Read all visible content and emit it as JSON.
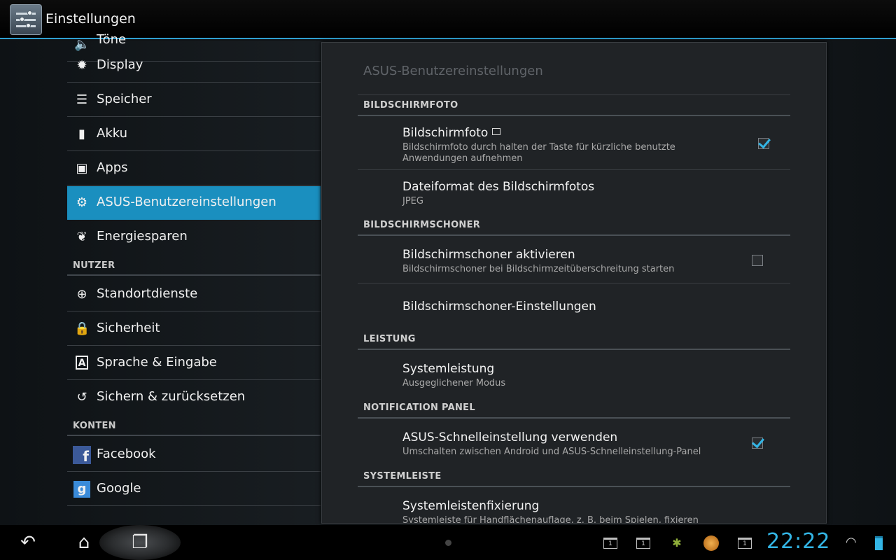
{
  "actionbar": {
    "title": "Einstellungen"
  },
  "sidebar": {
    "items": [
      {
        "label": "Töne"
      },
      {
        "label": "Display"
      },
      {
        "label": "Speicher"
      },
      {
        "label": "Akku"
      },
      {
        "label": "Apps"
      },
      {
        "label": "ASUS-Benutzereinstellungen"
      },
      {
        "label": "Energiesparen"
      },
      {
        "label": "Standortdienste"
      },
      {
        "label": "Sicherheit"
      },
      {
        "label": "Sprache & Eingabe"
      },
      {
        "label": "Sichern & zurücksetzen"
      },
      {
        "label": "Facebook"
      },
      {
        "label": "Google"
      }
    ],
    "sections": [
      "NUTZER",
      "KONTEN"
    ]
  },
  "panel": {
    "title": "ASUS-Benutzereinstellungen",
    "headers": [
      "BILDSCHIRMFOTO",
      "BILDSCHIRMSCHONER",
      "LEISTUNG",
      "NOTIFICATION PANEL",
      "SYSTEMLEISTE"
    ],
    "prefs": [
      {
        "title": "Bildschirmfoto",
        "summary": "Bildschirmfoto durch halten der Taste für kürzliche benutzte Anwendungen aufnehmen",
        "checked": true
      },
      {
        "title": "Dateiformat des Bildschirmfotos",
        "summary": "JPEG"
      },
      {
        "title": "Bildschirmschoner aktivieren",
        "summary": "Bildschirmschoner bei Bildschirmzeitüberschreitung starten",
        "checked": false
      },
      {
        "title": "Bildschirmschoner-Einstellungen"
      },
      {
        "title": "Systemleistung",
        "summary": "Ausgeglichener Modus"
      },
      {
        "title": "ASUS-Schnelleinstellung verwenden",
        "summary": "Umschalten zwischen Android und ASUS-Schnelleinstellung-Panel",
        "checked": true
      },
      {
        "title": "Systemleistenfixierung",
        "summary": "Systemleiste für Handflächenauflage, z. B. beim Spielen, fixieren"
      }
    ]
  },
  "statusbar": {
    "clock": "22:22",
    "notification_badge": "1"
  },
  "colors": {
    "accent": "#33b5e5",
    "selected": "#1a8fbf"
  }
}
